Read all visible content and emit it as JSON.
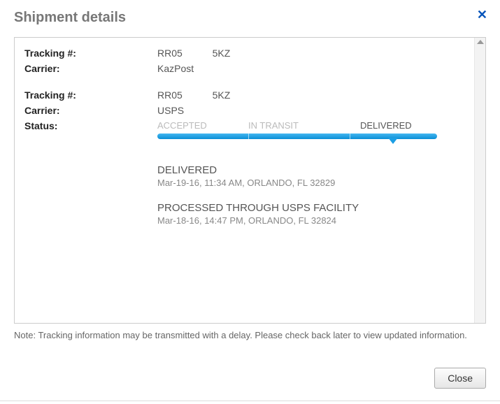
{
  "header": {
    "title": "Shipment details"
  },
  "shipments": [
    {
      "tracking_label": "Tracking #:",
      "tracking_value": "RR05           5KZ",
      "carrier_label": "Carrier:",
      "carrier_value": "KazPost"
    },
    {
      "tracking_label": "Tracking #:",
      "tracking_value": "RR05           5KZ",
      "carrier_label": "Carrier:",
      "carrier_value": "USPS"
    }
  ],
  "status": {
    "label": "Status:",
    "steps": {
      "accepted": "ACCEPTED",
      "in_transit": "IN TRANSIT",
      "delivered": "DELIVERED"
    }
  },
  "events": [
    {
      "title": "DELIVERED",
      "detail": "Mar-19-16, 11:34 AM, ORLANDO, FL 32829"
    },
    {
      "title": "PROCESSED THROUGH USPS FACILITY",
      "detail": "Mar-18-16, 14:47 PM, ORLANDO, FL 32824"
    }
  ],
  "note": "Note: Tracking information may be transmitted with a delay. Please check back later to view updated information.",
  "footer": {
    "close_label": "Close"
  }
}
